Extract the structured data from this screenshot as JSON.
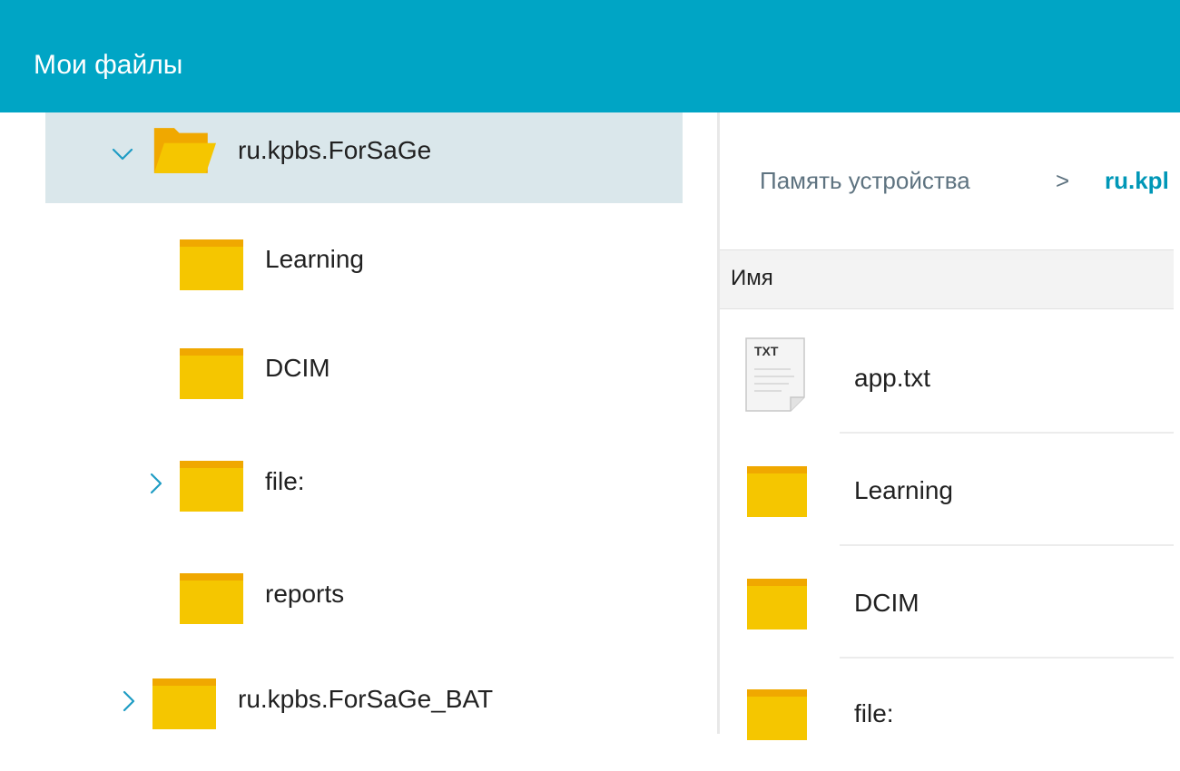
{
  "appbar": {
    "title": "Мои файлы"
  },
  "tree": {
    "items": [
      {
        "label": "ru.kpbs.ForSaGe",
        "expanded": true,
        "selected": true,
        "open_folder": true
      },
      {
        "label": "Learning"
      },
      {
        "label": "DCIM"
      },
      {
        "label": "file:",
        "expandable": true
      },
      {
        "label": "reports"
      },
      {
        "label": "ru.kpbs.ForSaGe_BAT",
        "expandable": true
      }
    ]
  },
  "breadcrumb": {
    "root": "Память устройства",
    "separator": ">",
    "current": "ru.kpl"
  },
  "list": {
    "column_header": "Имя",
    "files": [
      {
        "name": "app.txt",
        "icon": "txt-file-icon",
        "icon_text": "TXT"
      },
      {
        "name": "Learning",
        "icon": "folder-icon"
      },
      {
        "name": "DCIM",
        "icon": "folder-icon"
      },
      {
        "name": "file:",
        "icon": "folder-icon"
      }
    ]
  },
  "colors": {
    "appbar": "#00a5c5",
    "selected_row": "#dae7eb",
    "folder": "#f5c600",
    "folder_tab": "#f0a800",
    "chevron": "#1e9cc4",
    "breadcrumb_current": "#0097b7"
  }
}
